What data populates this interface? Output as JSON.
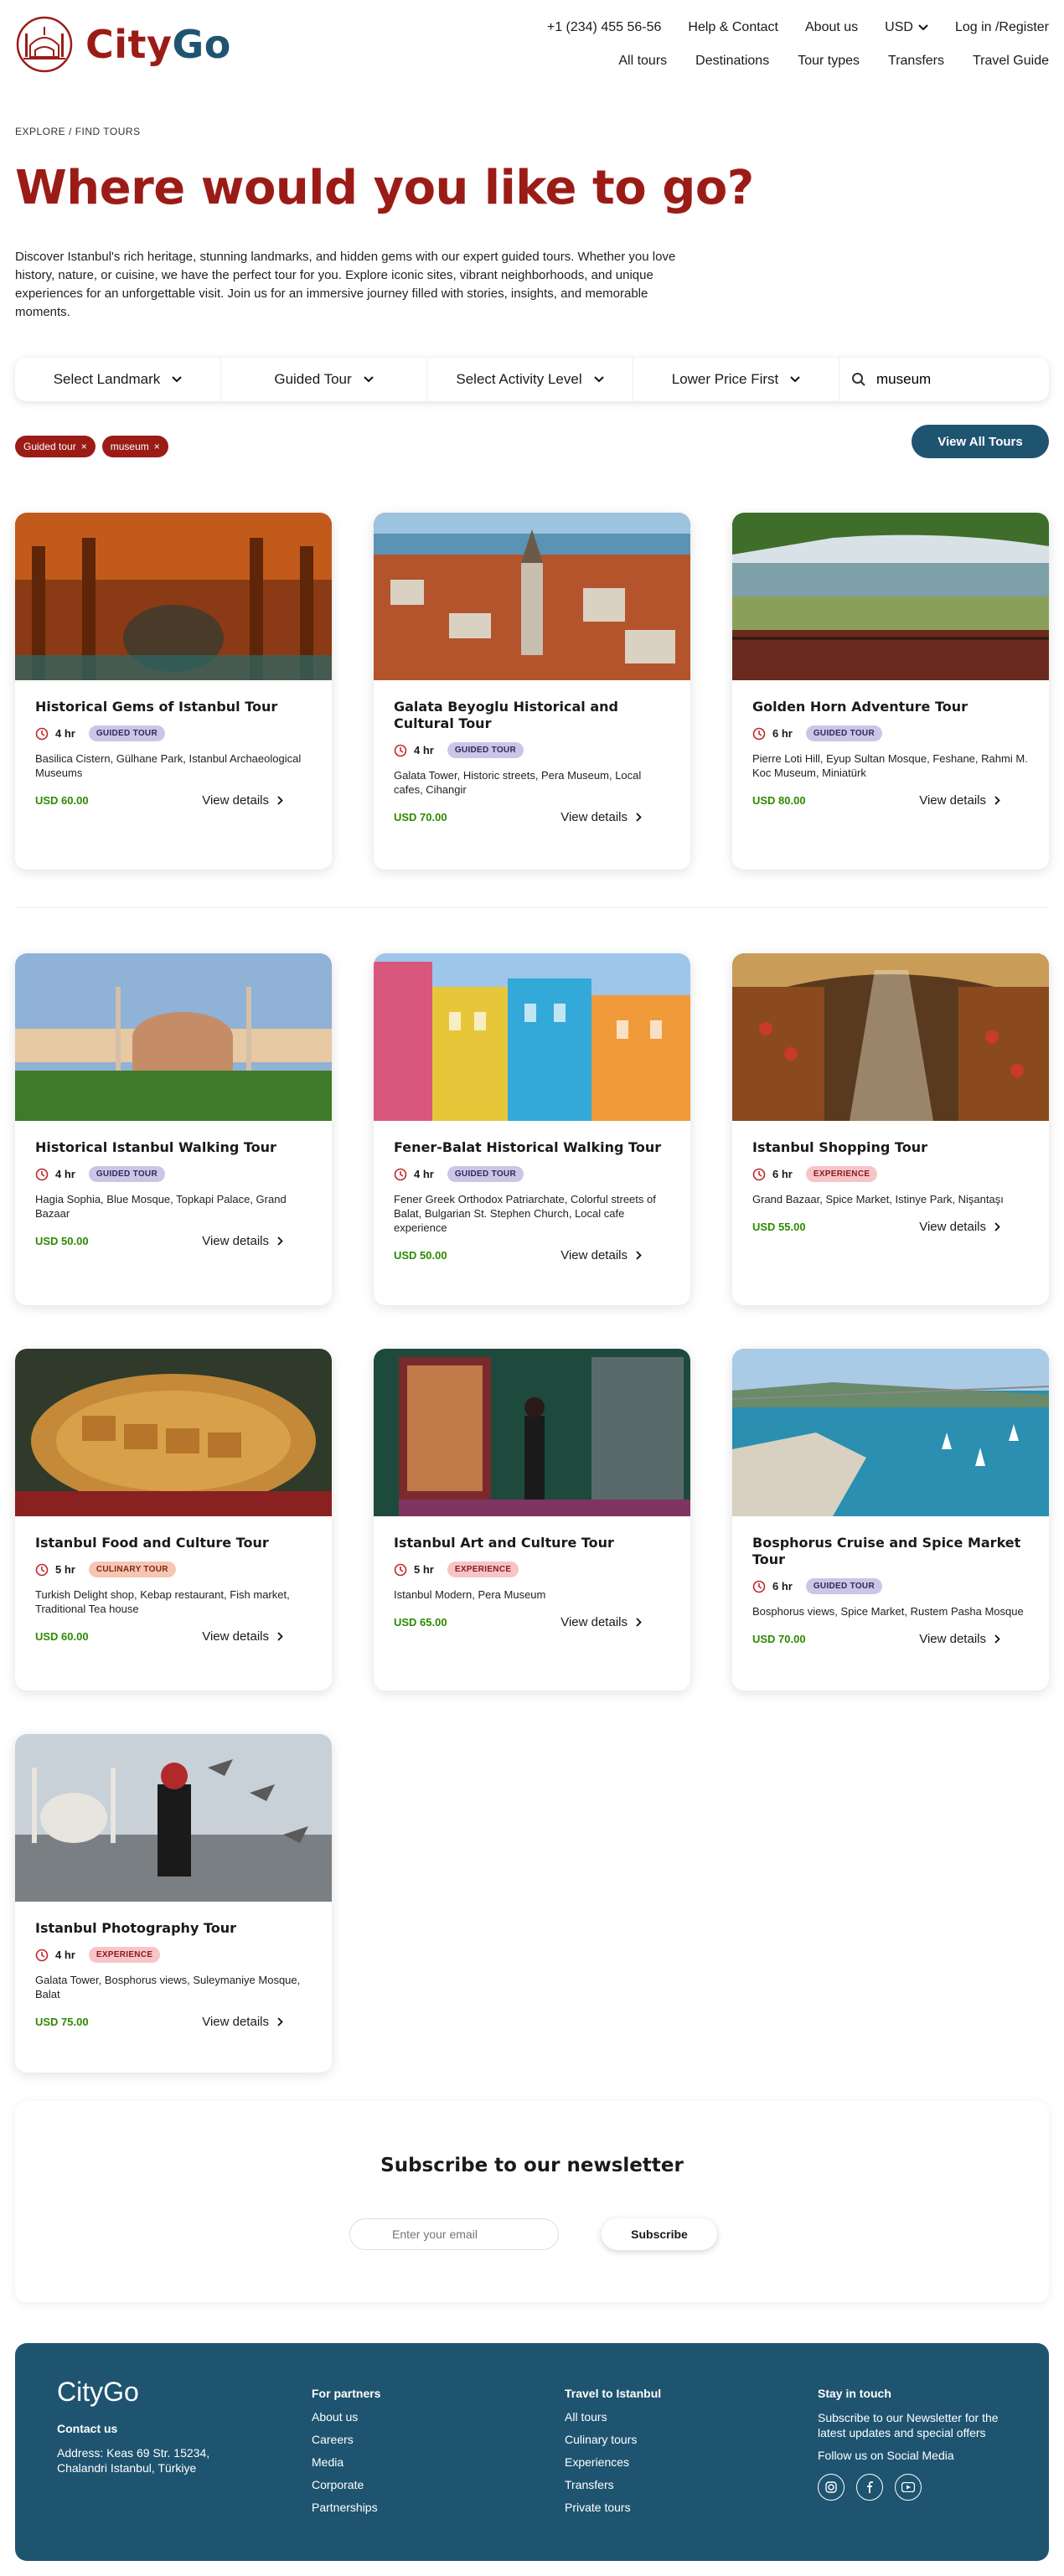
{
  "header": {
    "brand_a": "City",
    "brand_b": "Go",
    "phone": "+1 (234) 455 56-56",
    "help": "Help & Contact",
    "about": "About us",
    "currency": "USD",
    "login": "Log in /Register",
    "nav": [
      "All tours",
      "Destinations",
      "Tour types",
      "Transfers",
      "Travel Guide"
    ]
  },
  "breadcrumb": "EXPLORE / FIND TOURS",
  "hero": {
    "title": "Where would you like to go?",
    "description": "Discover Istanbul's rich heritage, stunning landmarks, and hidden gems with our expert guided tours. Whether you love history, nature, or cuisine, we have the perfect tour for you. Explore iconic sites, vibrant neighborhoods, and unique experiences for an unforgettable visit. Join us for an immersive journey filled with stories, insights, and memorable moments."
  },
  "filters": {
    "landmark": "Select Landmark",
    "tour_type": "Guided Tour",
    "activity": "Select Activity Level",
    "sort": "Lower Price First",
    "search_value": "museum"
  },
  "chips": [
    "Guided tour",
    "museum"
  ],
  "view_all": "View All Tours",
  "details_label": "View details",
  "tours": [
    {
      "title": "Historical Gems of Istanbul Tour",
      "duration": "4 hr",
      "badge": "GUIDED TOUR",
      "sites": "Basilica Cistern, Gülhane Park, Istanbul Archaeological Museums",
      "price": "USD 60.00"
    },
    {
      "title": "Galata Beyoglu Historical and Cultural Tour",
      "duration": "4 hr",
      "badge": "GUIDED TOUR",
      "sites": "Galata Tower, Historic streets, Pera Museum, Local cafes, Cihangir",
      "price": "USD 70.00"
    },
    {
      "title": "Golden Horn Adventure Tour",
      "duration": "6 hr",
      "badge": "GUIDED TOUR",
      "sites": "Pierre Loti Hill, Eyup Sultan Mosque, Feshane, Rahmi M. Koc Museum, Miniatürk",
      "price": "USD 80.00"
    },
    {
      "title": "Historical Istanbul Walking Tour",
      "duration": "4 hr",
      "badge": "GUIDED TOUR",
      "sites": "Hagia Sophia, Blue Mosque, Topkapi Palace, Grand Bazaar",
      "price": "USD 50.00"
    },
    {
      "title": "Fener-Balat Historical Walking Tour",
      "duration": "4 hr",
      "badge": "GUIDED TOUR",
      "sites": "Fener Greek Orthodox Patriarchate, Colorful streets of Balat, Bulgarian St. Stephen Church, Local cafe experience",
      "price": "USD 50.00"
    },
    {
      "title": "Istanbul Shopping Tour",
      "duration": "6 hr",
      "badge": "EXPERIENCE",
      "sites": "Grand Bazaar, Spice Market, Istinye Park, Nişantaşı",
      "price": "USD 55.00"
    },
    {
      "title": "Istanbul Food and Culture Tour",
      "duration": "5 hr",
      "badge": "CULINARY TOUR",
      "sites": "Turkish Delight shop, Kebap restaurant, Fish market, Traditional Tea house",
      "price": "USD 60.00"
    },
    {
      "title": "Istanbul Art and Culture Tour",
      "duration": "5 hr",
      "badge": "EXPERIENCE",
      "sites": "Istanbul Modern, Pera Museum",
      "price": "USD 65.00"
    },
    {
      "title": "Bosphorus Cruise and Spice Market Tour",
      "duration": "6 hr",
      "badge": "GUIDED TOUR",
      "sites": "Bosphorus views, Spice Market, Rustem Pasha Mosque",
      "price": "USD 70.00"
    },
    {
      "title": "Istanbul Photography Tour",
      "duration": "4 hr",
      "badge": "EXPERIENCE",
      "sites": "Galata Tower, Bosphorus views, Suleymaniye Mosque, Balat",
      "price": "USD 75.00"
    }
  ],
  "newsletter": {
    "title": "Subscribe to our newsletter",
    "placeholder": "Enter your email",
    "button": "Subscribe"
  },
  "footer": {
    "brand": "CityGo",
    "contact_heading": "Contact us",
    "address": "Address: Keas 69 Str. 15234, Chalandri Istanbul, Türkiye",
    "partners": {
      "heading": "For partners",
      "items": [
        "About us",
        "Careers",
        "Media",
        "Corporate",
        "Partnerships"
      ]
    },
    "travel": {
      "heading": "Travel to Istanbul",
      "items": [
        "All tours",
        "Culinary tours",
        "Experiences",
        "Transfers",
        "Private tours"
      ]
    },
    "stay": {
      "heading": "Stay in touch",
      "text": "Subscribe to our Newsletter for the latest updates and special offers",
      "social_text": "Follow us on Social Media",
      "icons": [
        "instagram-icon",
        "facebook-icon",
        "youtube-icon"
      ]
    }
  },
  "colors": {
    "brand_red": "#9b1c17",
    "brand_blue": "#1f5470",
    "price_green": "#2e8a00"
  }
}
